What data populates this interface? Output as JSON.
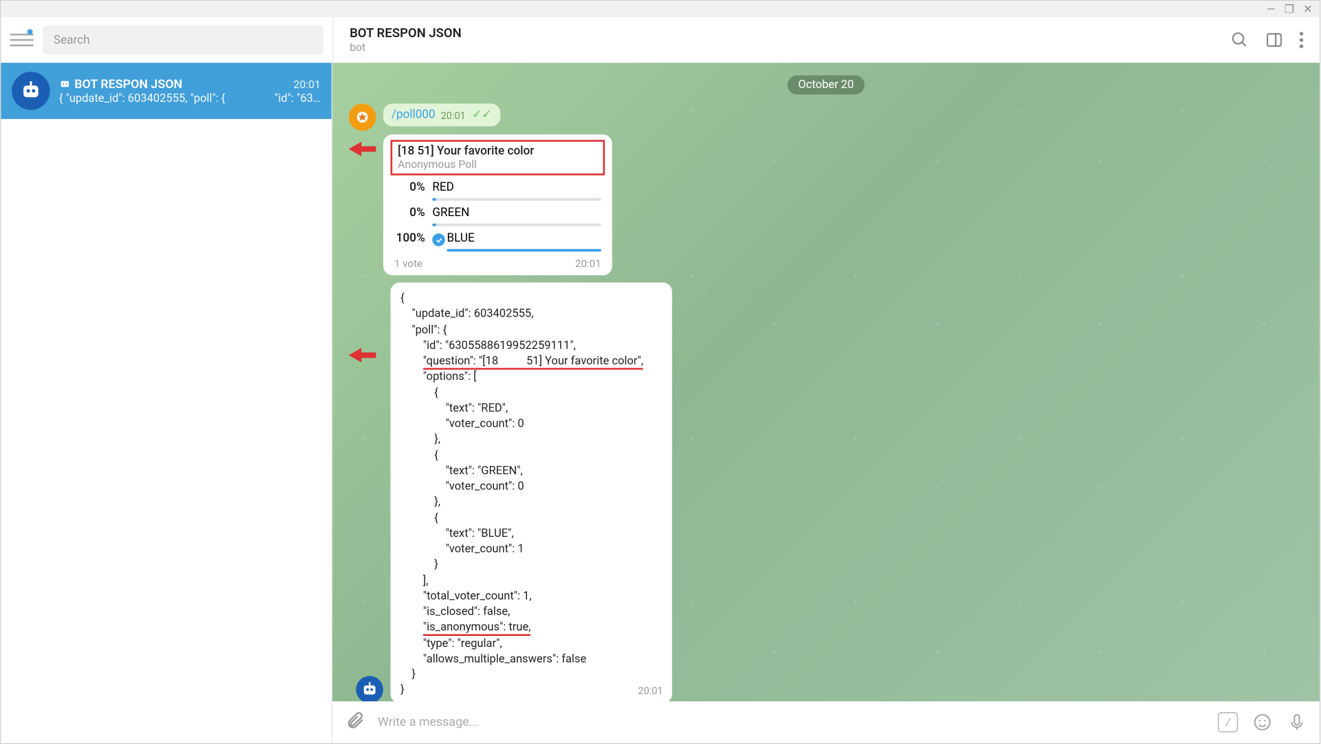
{
  "window": {
    "minimize": "—",
    "maximize": "❐",
    "close": "✕"
  },
  "search": {
    "placeholder": "Search"
  },
  "header": {
    "title": "BOT RESPON JSON",
    "subtitle": "bot"
  },
  "sidebar": {
    "chat": {
      "name": "BOT RESPON JSON",
      "time": "20:01",
      "preview_left": "{    \"update_id\": 603402555,    \"poll\": {",
      "preview_right": "\"id\": \"63…"
    }
  },
  "date_badge": "October 20",
  "command_msg": {
    "text": "/poll000",
    "time": "20:01"
  },
  "poll": {
    "question": "[18          51] Your favorite color",
    "subtitle": "Anonymous Poll",
    "options": [
      {
        "pct": "0%",
        "label": "RED",
        "fill": 0
      },
      {
        "pct": "0%",
        "label": "GREEN",
        "fill": 0
      },
      {
        "pct": "100%",
        "label": "BLUE",
        "fill": 100,
        "checked": true
      }
    ],
    "votes": "1 vote",
    "time": "20:01"
  },
  "json_msg": {
    "lines": {
      "l1": "{",
      "l2": "    \"update_id\": 603402555,",
      "l3": "    \"poll\": {",
      "l4": "        \"id\": \"6305588619952259111\",",
      "l5a": "        ",
      "l5b": "\"question\": \"[18          51] Your favorite color\",",
      "l6": "        \"options\": [",
      "l7": "            {",
      "l8": "                \"text\": \"RED\",",
      "l9": "                \"voter_count\": 0",
      "l10": "            },",
      "l11": "            {",
      "l12": "                \"text\": \"GREEN\",",
      "l13": "                \"voter_count\": 0",
      "l14": "            },",
      "l15": "            {",
      "l16": "                \"text\": \"BLUE\",",
      "l17": "                \"voter_count\": 1",
      "l18": "            }",
      "l19": "        ],",
      "l20": "        \"total_voter_count\": 1,",
      "l21": "        \"is_closed\": false,",
      "l22a": "        ",
      "l22b": "\"is_anonymous\": true,",
      "l23": "        \"type\": \"regular\",",
      "l24": "        \"allows_multiple_answers\": false",
      "l25": "    }",
      "l26": "}"
    },
    "time": "20:01"
  },
  "composer": {
    "placeholder": "Write a message...",
    "slash": "/"
  }
}
